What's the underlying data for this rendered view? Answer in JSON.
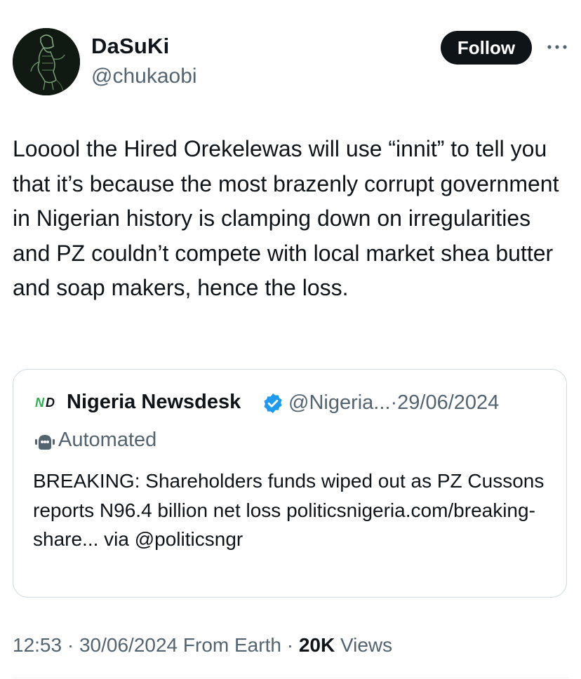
{
  "author": {
    "display_name": "DaSuKi",
    "handle": "@chukaobi",
    "avatar_icon": "masked-figure-avatar"
  },
  "actions": {
    "follow_label": "Follow",
    "more_icon": "more-horizontal-icon"
  },
  "tweet": {
    "text": "Looool the Hired Orekelewas will use “innit” to tell you that it’s because the most brazenly corrupt government in Nigerian history is clamping down on irregularities and PZ couldn’t compete with local market shea butter and soap makers, hence the loss."
  },
  "quote": {
    "logo_text": "ND",
    "display_name": "Nigeria Newsdesk",
    "verified": true,
    "handle": "@Nigeria...",
    "separator": "·",
    "date": "29/06/2024",
    "automated_label": "Automated",
    "text": "BREAKING: Shareholders funds wiped out as PZ Cussons reports N96.4 billion net loss politicsnigeria.com/breaking-share... via @politicsngr"
  },
  "meta": {
    "time": "12:53",
    "date": "30/06/2024",
    "source": "From Earth",
    "views_count": "20K",
    "views_label": "Views"
  },
  "colors": {
    "text": "#0f1419",
    "secondary": "#536471",
    "border": "#cfd9de",
    "verified": "#1d9bf0",
    "logo_green": "#2bb24c"
  }
}
